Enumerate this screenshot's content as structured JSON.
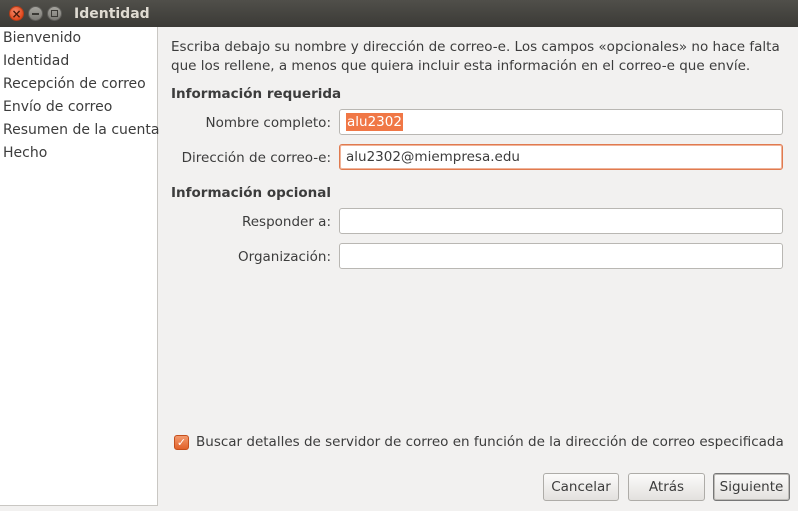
{
  "window": {
    "title": "Identidad"
  },
  "sidebar": {
    "items": [
      {
        "label": "Bienvenido"
      },
      {
        "label": "Identidad"
      },
      {
        "label": "Recepción de correo"
      },
      {
        "label": "Envío de correo"
      },
      {
        "label": "Resumen de la cuenta"
      },
      {
        "label": "Hecho"
      }
    ]
  },
  "main": {
    "intro_line1": "Escriba debajo su nombre y dirección de correo-e. Los campos «opcionales» no hace falta",
    "intro_line2": "que los rellene, a menos que quiera incluir esta información en el correo-e que envíe.",
    "required_title": "Información requerida",
    "fullname_label": "Nombre completo:",
    "fullname_value": "alu2302",
    "email_label": "Dirección de correo-e:",
    "email_value": "alu2302@miempresa.edu",
    "optional_title": "Información opcional",
    "replyto_label": "Responder a:",
    "replyto_value": "",
    "org_label": "Organización:",
    "org_value": "",
    "lookup_label": "Buscar detalles de servidor de correo en función de la dirección de correo especificada",
    "lookup_checked": true
  },
  "buttons": {
    "cancel": "Cancelar",
    "back": "Atrás",
    "next": "Siguiente"
  },
  "colors": {
    "accent": "#f07746",
    "titlebar": "#3b3a36",
    "close": "#e2491d"
  }
}
